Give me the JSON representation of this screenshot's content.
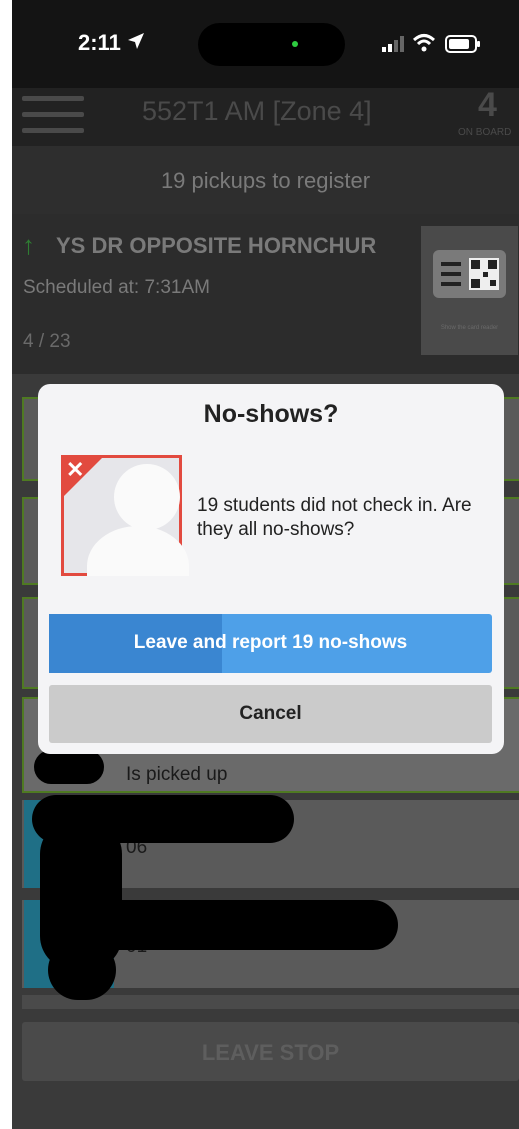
{
  "status_bar": {
    "time": "2:11"
  },
  "header": {
    "title": "552T1 AM [Zone 4]",
    "on_board_count": "4",
    "on_board_label": "ON BOARD"
  },
  "pickups": {
    "text": "19 pickups to register"
  },
  "stop": {
    "name": "YS DR OPPOSITE HORNCHUR",
    "scheduled": "Scheduled at: 7:31AM",
    "progress": "4 / 23",
    "card_reader_label": "Show the card reader"
  },
  "dialog": {
    "title": "No-shows?",
    "message": "19 students did not check in. Are they all no-shows?",
    "report_button": "Leave and report 19 no-shows",
    "report_progress": 0.39,
    "cancel_button": "Cancel"
  },
  "list": {
    "row4_status": "Is picked up",
    "row5_text": "06",
    "row6_text": "01"
  },
  "footer": {
    "leave_stop": "LEAVE STOP"
  },
  "colors": {
    "accent_blue": "#4ea0e8",
    "alert_red": "#e24a3f",
    "picked_green": "#4f7a22"
  }
}
